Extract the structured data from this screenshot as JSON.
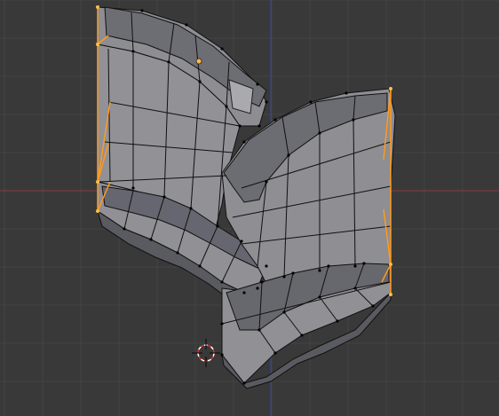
{
  "app": {
    "view": "3d-viewport-edit-mode",
    "colors": {
      "background": "#393939",
      "grid": "#444444",
      "axis_red": "#8a3b3b",
      "axis_blue": "#3b4a8a",
      "face": "#909094",
      "face_dark": "#6f6f74",
      "face_side": "#5d5d64",
      "edge": "#000000",
      "selected_edge": "#ff9a1f",
      "selected_vertex": "#ffbf40",
      "cursor_red": "#e03030",
      "cursor_white": "#ffffff",
      "origin": "#ffb84a"
    },
    "icons": [
      "3d-cursor-icon",
      "object-origin-icon"
    ]
  }
}
